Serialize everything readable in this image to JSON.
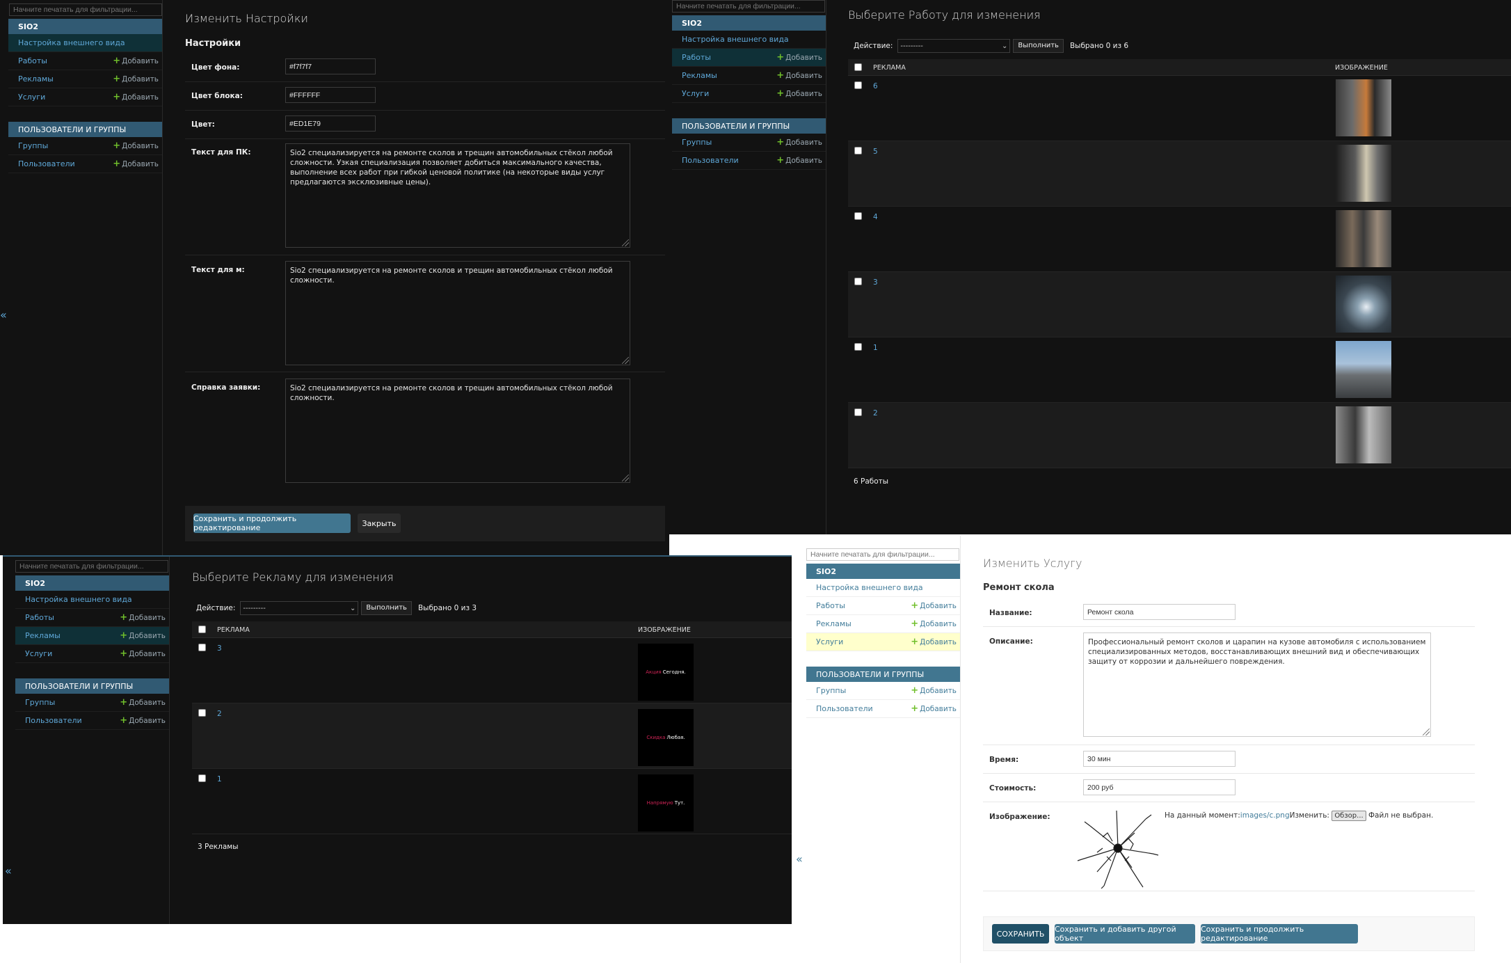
{
  "nav": {
    "filter_placeholder": "Начните печатать для фильтрации...",
    "app_sio2": "SIO2",
    "appearance": "Настройка внешнего вида",
    "works": "Работы",
    "ads": "Рекламы",
    "services": "Услуги",
    "users_groups": "ПОЛЬЗОВАТЕЛИ И ГРУППЫ",
    "groups": "Группы",
    "users": "Пользователи",
    "add": "Добавить",
    "collapse": "«"
  },
  "settings_panel": {
    "title": "Изменить Настройки",
    "section": "Настройки",
    "bg_label": "Цвет фона:",
    "bg_value": "#f7f7f7",
    "block_label": "Цвет блока:",
    "block_value": "#FFFFFF",
    "color_label": "Цвет:",
    "color_value": "#ED1E79",
    "pc_text_label": "Текст для ПК:",
    "pc_text_value": "Sio2 специализируется на ремонте сколов и трещин автомобильных стёкол любой сложности. Узкая специализация позволяет добиться максимального качества, выполнение всех работ при гибкой ценовой политике (на некоторые виды услуг предлагаются эксклюзивные цены).",
    "m_text_label": "Текст для м:",
    "m_text_value": "Sio2 специализируется на ремонте сколов и трещин автомобильных стёкол любой сложности.",
    "ref_label": "Справка заявки:",
    "ref_value": "Sio2 специализируется на ремонте сколов и трещин автомобильных стёкол любой сложности.",
    "save_continue": "Сохранить и продолжить редактирование",
    "close": "Закрыть"
  },
  "works_panel": {
    "title": "Выберите Работу для изменения",
    "action_label": "Действие:",
    "select_value": "---------",
    "go": "Выполнить",
    "selected": "Выбрано 0 из 6",
    "col_ad": "РЕКЛАМА",
    "col_image": "ИЗОБРАЖЕНИЕ",
    "rows": [
      "6",
      "5",
      "4",
      "3",
      "1",
      "2"
    ],
    "count": "6 Работы"
  },
  "ads_panel": {
    "title": "Выберите Рекламу для изменения",
    "action_label": "Действие:",
    "select_value": "---------",
    "go": "Выполнить",
    "selected": "Выбрано 0 из 3",
    "col_ad": "РЕКЛАМА",
    "col_image": "ИЗОБРАЖЕНИЕ",
    "rows": [
      {
        "id": "3",
        "red": "Акция",
        "white": "Сегодня."
      },
      {
        "id": "2",
        "red": "Скидка",
        "white": "Любая."
      },
      {
        "id": "1",
        "red": "Напрямую",
        "white": "Тут."
      }
    ],
    "count": "3 Рекламы"
  },
  "service_panel": {
    "title": "Изменить Услугу",
    "section": "Ремонт скола",
    "name_label": "Название:",
    "name_value": "Ремонт скола",
    "desc_label": "Описание:",
    "desc_value": "Профессиональный ремонт сколов и царапин на кузове автомобиля с использованием специализированных методов, восстанавливающих внешний вид и обеспечивающих защиту от коррозии и дальнейшего повреждения.",
    "time_label": "Время:",
    "time_value": "30 мин",
    "price_label": "Стоимость:",
    "price_value": "200 руб",
    "image_label": "Изображение:",
    "current_text": "На данный момент:",
    "current_link": "images/c.png",
    "change_text": "Изменить:",
    "browse": "Обзор...",
    "no_file": "Файл не выбран.",
    "save": "СОХРАНИТЬ",
    "save_add": "Сохранить и добавить другой объект",
    "save_continue": "Сохранить и продолжить редактирование"
  },
  "colors": {
    "dark_bg": "#121212",
    "module_header": "#315a73",
    "light_header": "#417690",
    "link": "#5fa8d8",
    "add_plus": "#70bf2b",
    "ad_red": "#cf2456"
  }
}
